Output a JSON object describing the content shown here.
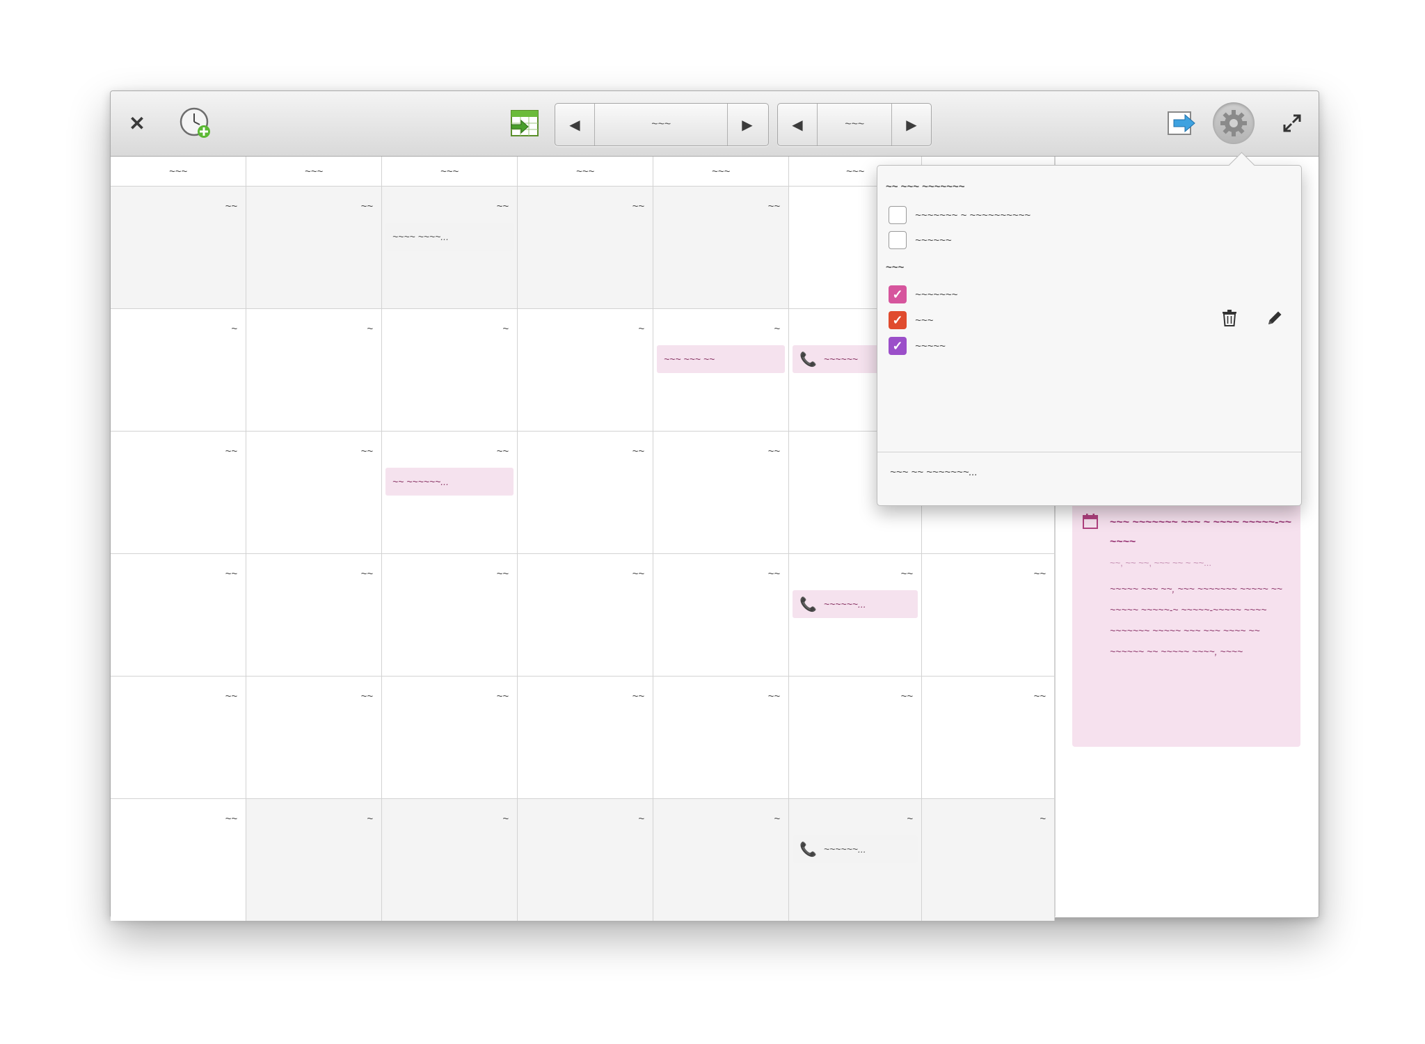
{
  "toolbar": {
    "month_label": "~~~",
    "year_label": "~~~"
  },
  "weekdays": [
    "~~~",
    "~~~",
    "~~~",
    "~~~",
    "~~~",
    "~~~",
    "~~~"
  ],
  "weeks": [
    [
      {
        "num": "~~",
        "other": true
      },
      {
        "num": "~~",
        "other": true
      },
      {
        "num": "~~",
        "other": true,
        "event": {
          "text": "~~~~ ~~~~...",
          "color": "gray"
        }
      },
      {
        "num": "~~",
        "other": true
      },
      {
        "num": "~~",
        "other": true
      },
      {
        "num": "",
        "other": false
      },
      {
        "num": "",
        "other": false
      }
    ],
    [
      {
        "num": "~"
      },
      {
        "num": "~"
      },
      {
        "num": "~"
      },
      {
        "num": "~"
      },
      {
        "num": "~",
        "event": {
          "text": "~~~ ~~~ ~~",
          "color": "pink"
        }
      },
      {
        "num": "",
        "event": {
          "text": "~~~~~~",
          "color": "pink",
          "phone": true
        }
      },
      {
        "num": ""
      }
    ],
    [
      {
        "num": "~~"
      },
      {
        "num": "~~"
      },
      {
        "num": "~~",
        "event": {
          "text": "~~ ~~~~~~...",
          "color": "pink"
        }
      },
      {
        "num": "~~"
      },
      {
        "num": "~~"
      },
      {
        "num": ""
      },
      {
        "num": ""
      }
    ],
    [
      {
        "num": "~~"
      },
      {
        "num": "~~"
      },
      {
        "num": "~~"
      },
      {
        "num": "~~"
      },
      {
        "num": "~~"
      },
      {
        "num": "~~",
        "event": {
          "text": "~~~~~~...",
          "color": "pink",
          "phone": true
        }
      },
      {
        "num": "~~"
      }
    ],
    [
      {
        "num": "~~"
      },
      {
        "num": "~~"
      },
      {
        "num": "~~"
      },
      {
        "num": "~~"
      },
      {
        "num": "~~"
      },
      {
        "num": "~~"
      },
      {
        "num": "~~"
      }
    ],
    [
      {
        "num": "~~"
      },
      {
        "num": "~",
        "other": true
      },
      {
        "num": "~",
        "other": true
      },
      {
        "num": "~",
        "other": true
      },
      {
        "num": "~",
        "other": true
      },
      {
        "num": "~",
        "other": true,
        "event": {
          "text": "~~~~~~...",
          "color": "gray",
          "phone": true
        }
      },
      {
        "num": "~",
        "other": true
      }
    ]
  ],
  "detail": {
    "title": "~~~ ~~~~~~~ ~~~ ~ ~~~~ ~~~~~-~~ ~~~~",
    "date": "~~, ~~ ~~, ~~~ ~~ ~ ~~...",
    "description": "~~~~~ ~~~ ~~, ~~~ ~~~~~~~ ~~~~~ ~~ ~~~~~ ~~~~~-~ ~~~~~-~~~~~ ~~~~ ~~~~~~~ ~~~~~ ~~~ ~~~ ~~~~ ~~ ~~~~~~ ~~ ~~~~~ ~~~~, ~~~~"
  },
  "popover": {
    "heading1": "~~ ~~~ ~~~~~~~",
    "options": [
      {
        "label": "~~~~~~~ ~ ~~~~~~~~~~",
        "checked": false
      },
      {
        "label": "~~~~~~",
        "checked": false
      }
    ],
    "heading2": "~~~",
    "calendars": [
      {
        "label": "~~~~~~~",
        "checked": true,
        "color": "#d6559d"
      },
      {
        "label": "~~~",
        "checked": true,
        "color": "#e04b2e",
        "actions": true
      },
      {
        "label": "~~~~~",
        "checked": true,
        "color": "#9b4fc9"
      }
    ],
    "footer": "~~~ ~~ ~~~~~~~..."
  },
  "colors": {
    "event_pink": "#f5e2ee",
    "event_text": "#8a3766",
    "accent_magenta": "#d6559d",
    "accent_red": "#e04b2e",
    "accent_purple": "#9b4fc9"
  }
}
